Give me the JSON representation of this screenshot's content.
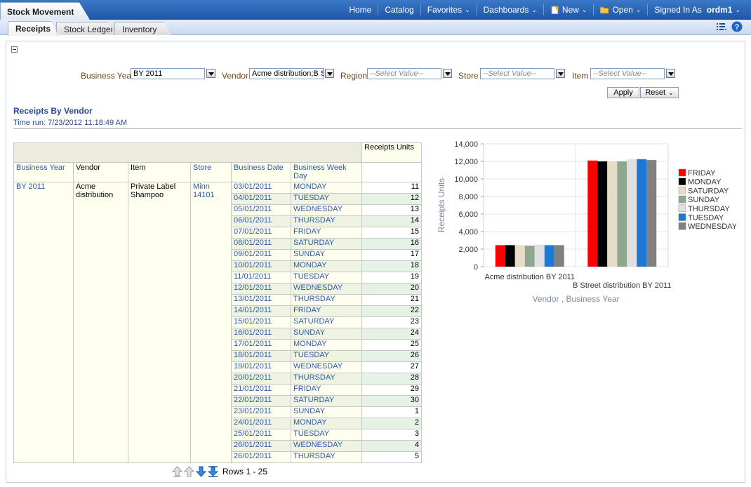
{
  "app_title": "Stock Movement",
  "nav": {
    "home": "Home",
    "catalog": "Catalog",
    "favorites": "Favorites",
    "dashboards": "Dashboards",
    "new": "New",
    "open": "Open",
    "signed_in_as": "Signed In As",
    "user": "ordm1"
  },
  "tabs": [
    {
      "label": "Receipts",
      "active": true
    },
    {
      "label": "Stock Ledger",
      "active": false
    },
    {
      "label": "Inventory",
      "active": false
    }
  ],
  "prompts": {
    "business_year": {
      "label": "Business Year",
      "value": "BY 2011"
    },
    "vendor": {
      "label": "Vendor",
      "value": "Acme distribution;B S"
    },
    "region": {
      "label": "Region",
      "placeholder": "--Select Value--"
    },
    "store": {
      "label": "Store",
      "placeholder": "--Select Value--"
    },
    "item": {
      "label": "Item",
      "placeholder": "--Select Value--"
    },
    "apply_label": "Apply",
    "reset_label": "Reset"
  },
  "report": {
    "title": "Receipts By Vendor",
    "time_run": "Time run: 7/23/2012 11:18:49 AM"
  },
  "table": {
    "measure_header": "Receipts Units",
    "columns": [
      "Business Year",
      "Vendor",
      "Item",
      "Store",
      "Business Date",
      "Business Week Day"
    ],
    "group": {
      "business_year": "BY 2011",
      "vendor": "Acme distribution",
      "item": "Private Label Shampoo",
      "store": "Minn 14101"
    },
    "rows": [
      {
        "date": "03/01/2011",
        "day": "MONDAY",
        "value": "11"
      },
      {
        "date": "04/01/2011",
        "day": "TUESDAY",
        "value": "12"
      },
      {
        "date": "05/01/2011",
        "day": "WEDNESDAY",
        "value": "13"
      },
      {
        "date": "06/01/2011",
        "day": "THURSDAY",
        "value": "14"
      },
      {
        "date": "07/01/2011",
        "day": "FRIDAY",
        "value": "15"
      },
      {
        "date": "08/01/2011",
        "day": "SATURDAY",
        "value": "16"
      },
      {
        "date": "09/01/2011",
        "day": "SUNDAY",
        "value": "17"
      },
      {
        "date": "10/01/2011",
        "day": "MONDAY",
        "value": "18"
      },
      {
        "date": "11/01/2011",
        "day": "TUESDAY",
        "value": "19"
      },
      {
        "date": "12/01/2011",
        "day": "WEDNESDAY",
        "value": "20"
      },
      {
        "date": "13/01/2011",
        "day": "THURSDAY",
        "value": "21"
      },
      {
        "date": "14/01/2011",
        "day": "FRIDAY",
        "value": "22"
      },
      {
        "date": "15/01/2011",
        "day": "SATURDAY",
        "value": "23"
      },
      {
        "date": "16/01/2011",
        "day": "SUNDAY",
        "value": "24"
      },
      {
        "date": "17/01/2011",
        "day": "MONDAY",
        "value": "25"
      },
      {
        "date": "18/01/2011",
        "day": "TUESDAY",
        "value": "26"
      },
      {
        "date": "19/01/2011",
        "day": "WEDNESDAY",
        "value": "27"
      },
      {
        "date": "20/01/2011",
        "day": "THURSDAY",
        "value": "28"
      },
      {
        "date": "21/01/2011",
        "day": "FRIDAY",
        "value": "29"
      },
      {
        "date": "22/01/2011",
        "day": "SATURDAY",
        "value": "30"
      },
      {
        "date": "23/01/2011",
        "day": "SUNDAY",
        "value": "1"
      },
      {
        "date": "24/01/2011",
        "day": "MONDAY",
        "value": "2"
      },
      {
        "date": "25/01/2011",
        "day": "TUESDAY",
        "value": "3"
      },
      {
        "date": "26/01/2011",
        "day": "WEDNESDAY",
        "value": "4"
      },
      {
        "date": "26/01/2011",
        "day": "THURSDAY",
        "value": "5"
      }
    ],
    "rows_label": "Rows 1 - 25"
  },
  "chart_data": {
    "type": "bar",
    "categories": [
      "Acme distribution BY 2011",
      "B Street distribution BY 2011"
    ],
    "series": [
      {
        "name": "FRIDAY",
        "color": "#ff0000",
        "values": [
          2450,
          12100
        ]
      },
      {
        "name": "MONDAY",
        "color": "#000000",
        "values": [
          2450,
          12000
        ]
      },
      {
        "name": "SATURDAY",
        "color": "#e6dcc8",
        "values": [
          2450,
          12000
        ]
      },
      {
        "name": "SUNDAY",
        "color": "#8fa68f",
        "values": [
          2400,
          12000
        ]
      },
      {
        "name": "THURSDAY",
        "color": "#e0e0e0",
        "values": [
          2500,
          12250
        ]
      },
      {
        "name": "TUESDAY",
        "color": "#1e78d2",
        "values": [
          2450,
          12250
        ]
      },
      {
        "name": "WEDNESDAY",
        "color": "#808080",
        "values": [
          2450,
          12150
        ]
      }
    ],
    "ylabel": "Receipts Units",
    "xlabel": "Vendor , Business Year",
    "ylim": [
      0,
      14000
    ],
    "yticks": [
      "0",
      "2,000",
      "4,000",
      "6,000",
      "8,000",
      "10,000",
      "12,000",
      "14,000"
    ],
    "legend_position": "right",
    "grid": true
  }
}
